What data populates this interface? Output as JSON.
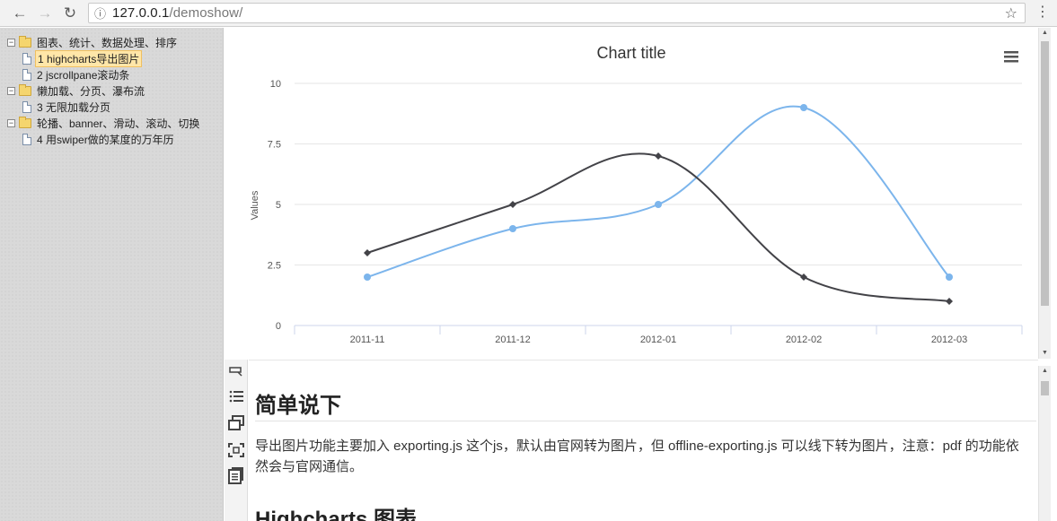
{
  "browser": {
    "url_host": "127.0.0.1",
    "url_path": "/demoshow/"
  },
  "tree": {
    "groups": [
      {
        "label": "图表、统计、数据处理、排序",
        "items": [
          "1 highcharts导出图片",
          "2 jscrollpane滚动条"
        ]
      },
      {
        "label": "懒加载、分页、瀑布流",
        "items": [
          "3 无限加载分页"
        ]
      },
      {
        "label": "轮播、banner、滑动、滚动、切换",
        "items": [
          "4 用swiper做的某度的万年历"
        ]
      }
    ],
    "selected": "1 highcharts导出图片"
  },
  "chart_data": {
    "type": "line",
    "title": "Chart title",
    "ylabel": "Values",
    "xlabel": "",
    "categories": [
      "2011-11",
      "2011-12",
      "2012-01",
      "2012-02",
      "2012-03"
    ],
    "ylim": [
      0,
      10
    ],
    "yticks": [
      "0",
      "2.5",
      "5",
      "7.5",
      "10"
    ],
    "grid": true,
    "series": [
      {
        "values": [
          2,
          4,
          5,
          9,
          2
        ],
        "color": "#7cb5ec",
        "marker": "circle"
      },
      {
        "values": [
          3,
          5,
          7,
          2,
          1
        ],
        "color": "#434348",
        "marker": "diamond"
      }
    ]
  },
  "doc": {
    "heading": "简单说下",
    "paragraph": "导出图片功能主要加入 exporting.js 这个js，默认由官网转为图片，但 offline-exporting.js 可以线下转为图片，注意：pdf 的功能依然会与官网通信。",
    "subheading": "Highcharts 图表"
  }
}
